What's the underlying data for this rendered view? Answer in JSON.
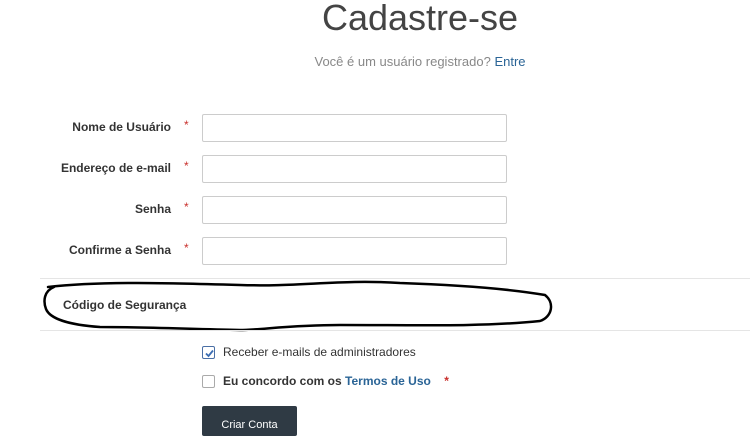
{
  "header": {
    "title": "Cadastre-se",
    "subtitle_text": "Você é um usuário registrado?",
    "login_link": "Entre"
  },
  "form": {
    "fields": [
      {
        "label": "Nome de Usuário",
        "required_mark": "*",
        "value": ""
      },
      {
        "label": "Endereço de e-mail",
        "required_mark": "*",
        "value": ""
      },
      {
        "label": "Senha",
        "required_mark": "*",
        "value": ""
      },
      {
        "label": "Confirme a Senha",
        "required_mark": "*",
        "value": ""
      }
    ],
    "security_code_label": "Código de Segurança",
    "admin_emails": {
      "label": "Receber e-mails de administradores",
      "checked": true
    },
    "terms": {
      "prefix": "Eu concordo com os",
      "link": "Termos de Uso",
      "required_mark": "*",
      "checked": false
    },
    "submit_label": "Criar Conta"
  },
  "colors": {
    "link": "#2a6496",
    "required": "#c9302c",
    "button_bg": "#2f3a44"
  }
}
